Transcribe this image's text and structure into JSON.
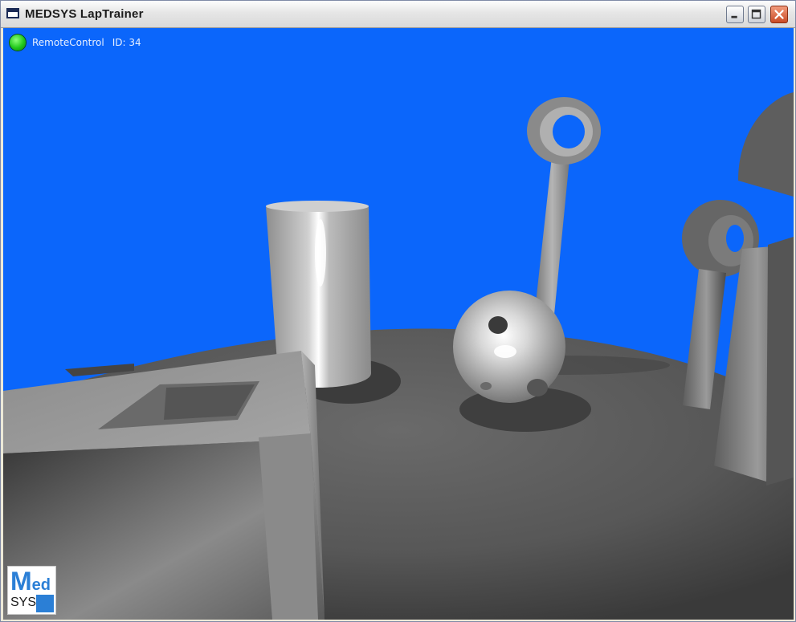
{
  "window": {
    "title": "MEDSYS LapTrainer",
    "controls": [
      "minimize",
      "maximize",
      "close"
    ]
  },
  "overlay": {
    "mode_label": "RemoteControl",
    "id_label": "ID:  34",
    "status_color": "#22cc1a"
  },
  "logo": {
    "line1_big": "M",
    "line1_small": "ed",
    "line2": "SYS"
  },
  "colors": {
    "sky": "#0b66fb",
    "floor": "#5a5a5a",
    "accent": "#2b7fd6"
  }
}
